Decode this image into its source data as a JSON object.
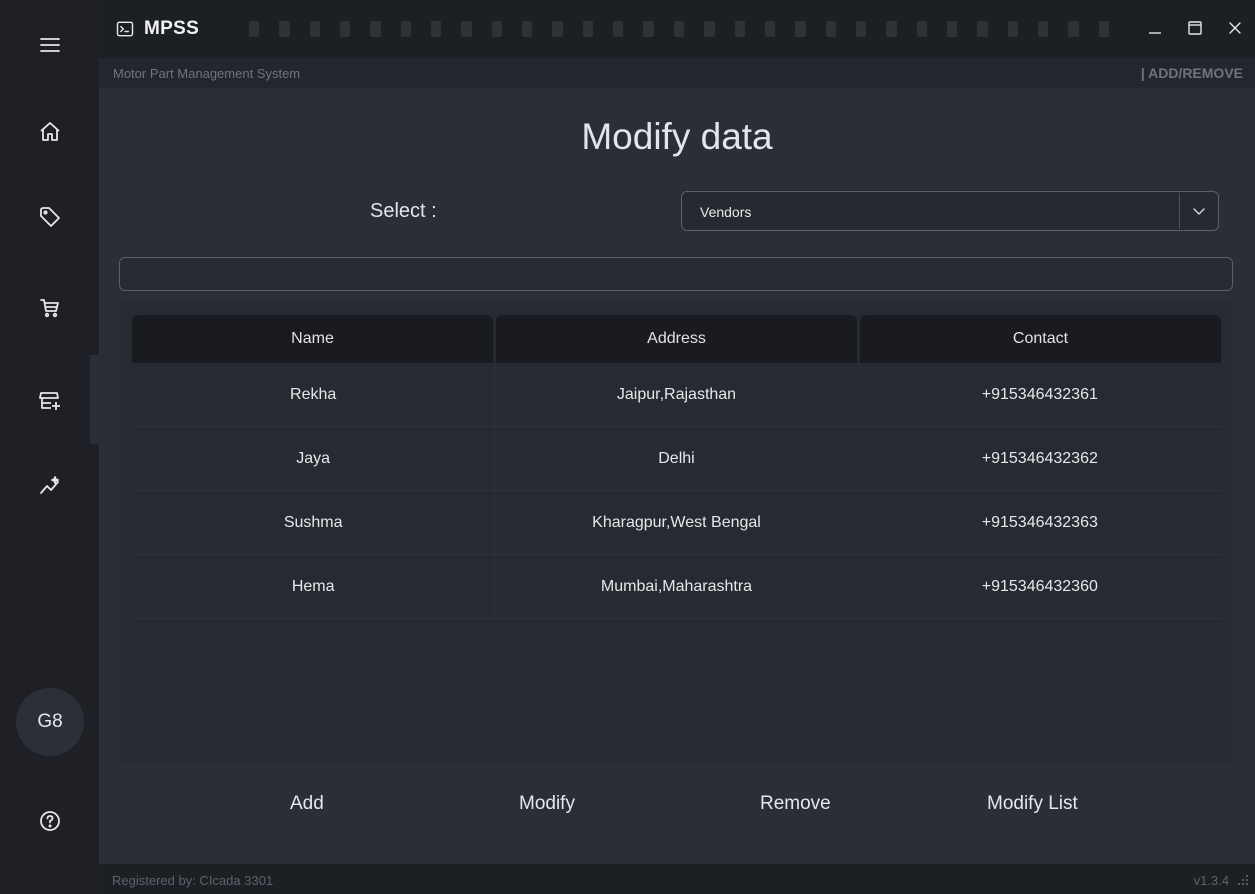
{
  "app": {
    "name": "MPSS",
    "subtitle": "Motor Part Management System",
    "section": "| ADD/REMOVE"
  },
  "sidebar": {
    "items": [
      {
        "id": "menu",
        "icon": "hamburger-menu-icon"
      },
      {
        "id": "home",
        "icon": "home-icon"
      },
      {
        "id": "parts",
        "icon": "tag-icon"
      },
      {
        "id": "cart",
        "icon": "cart-icon"
      },
      {
        "id": "add-store",
        "icon": "store-add-icon",
        "active": true
      },
      {
        "id": "analytics",
        "icon": "sparkline-icon"
      },
      {
        "id": "help",
        "icon": "help-icon"
      }
    ],
    "avatar_text": "G8"
  },
  "main": {
    "title": "Modify data",
    "select_label": "Select :",
    "select_value": "Vendors",
    "table": {
      "headers": [
        "Name",
        "Address",
        "Contact"
      ],
      "rows": [
        [
          "Rekha",
          "Jaipur,Rajasthan",
          "+915346432361"
        ],
        [
          "Jaya",
          "Delhi",
          "+915346432362"
        ],
        [
          "Sushma",
          "Kharagpur,West Bengal",
          "+915346432363"
        ],
        [
          "Hema",
          "Mumbai,Maharashtra",
          "+915346432360"
        ]
      ]
    },
    "actions": {
      "add": "Add",
      "modify": "Modify",
      "remove": "Remove",
      "modify_list": "Modify List"
    }
  },
  "footer": {
    "registered": "Registered by: CIcada 3301",
    "version": "v1.3.4"
  },
  "colors": {
    "sidebar_bg": "#1e2025",
    "content_bg": "#2a2e36",
    "titlebar_bg": "#1c1f24",
    "table_header_bg": "#191b20"
  }
}
